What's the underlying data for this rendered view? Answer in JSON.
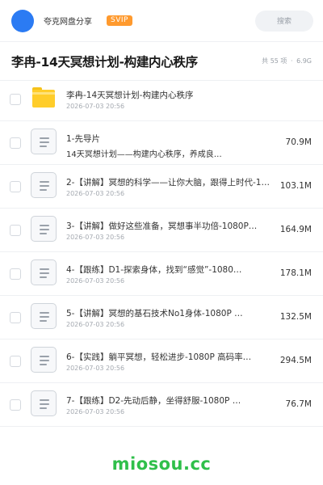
{
  "header": {
    "site_name": "夸克网盘分享",
    "badge": "SVIP",
    "search_placeholder": "搜索"
  },
  "folder": {
    "title": "李冉-14天冥想计划-构建内心秩序",
    "count_text": "共 55 项",
    "separator": "·",
    "total_size": "6.9G"
  },
  "files": [
    {
      "name": "李冉-14天冥想计划-构建内心秩序",
      "date": "2026-07-03 20:56",
      "size": "",
      "icon": "folder-icon"
    },
    {
      "name": "1-先导片",
      "date": "14天冥想计划——构建内心秩序，养成良…",
      "size": "70.9M",
      "icon": "document-icon"
    },
    {
      "name": "2-【讲解】冥想的科学——让你大脑，跟得上时代-1…",
      "date": "2026-07-03 20:56",
      "size": "103.1M",
      "icon": "document-icon"
    },
    {
      "name": "3-【讲解】做好这些准备，冥想事半功倍-1080P…",
      "date": "2026-07-03 20:56",
      "size": "164.9M",
      "icon": "document-icon"
    },
    {
      "name": "4-【跟练】D1-探索身体，找到“感觉”-1080…",
      "date": "2026-07-03 20:56",
      "size": "178.1M",
      "icon": "document-icon"
    },
    {
      "name": "5-【讲解】冥想的基石技术No1身体-1080P …",
      "date": "2026-07-03 20:56",
      "size": "132.5M",
      "icon": "document-icon"
    },
    {
      "name": "6-【实践】躺平冥想，轻松进步-1080P 高码率…",
      "date": "2026-07-03 20:56",
      "size": "294.5M",
      "icon": "document-icon"
    },
    {
      "name": "7-【跟练】D2-先动后静，坐得舒服-1080P …",
      "date": "2026-07-03 20:56",
      "size": "76.7M",
      "icon": "document-icon"
    }
  ],
  "watermark": "miosou.cc",
  "colors": {
    "accent": "#2b7bf3",
    "svip": "#ff9a2e",
    "folder": "#ffcd2a",
    "watermark": "#2fbf4a"
  }
}
